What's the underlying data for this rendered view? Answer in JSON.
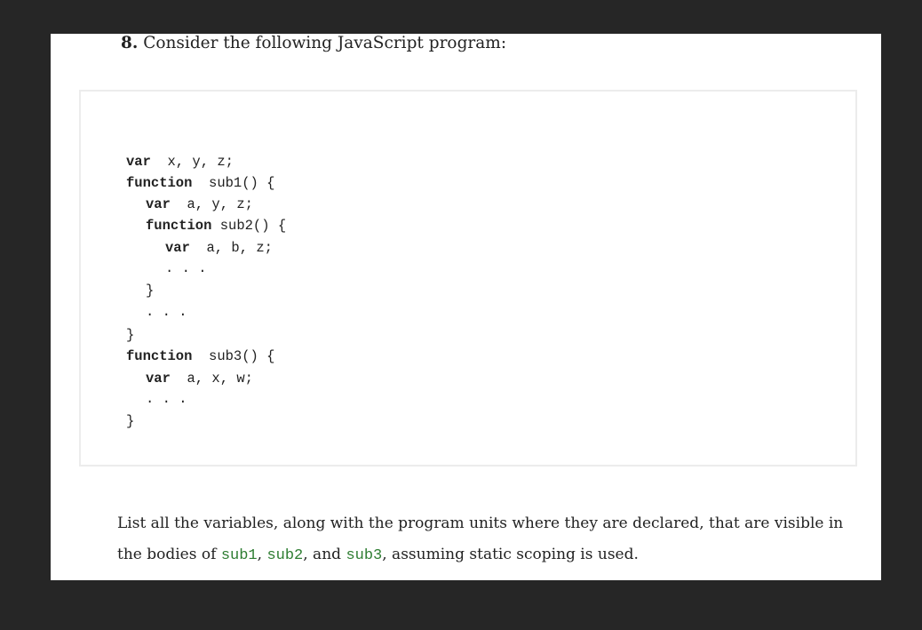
{
  "question": {
    "number": "8.",
    "heading": " Consider the following JavaScript program:"
  },
  "code": {
    "lines": [
      {
        "keyword": "var",
        "rest": "  x, y, z;"
      },
      {
        "keyword": "function",
        "rest": "  sub1() {"
      },
      {
        "keyword": "var",
        "rest": "  a, y, z;"
      },
      {
        "keyword": "function",
        "rest": " sub2() {"
      },
      {
        "keyword": "var",
        "rest": "  a, b, z;"
      },
      {
        "keyword": "",
        "rest": ". . ."
      },
      {
        "keyword": "",
        "rest": "}"
      },
      {
        "keyword": "",
        "rest": ". . ."
      },
      {
        "keyword": "",
        "rest": "}"
      },
      {
        "keyword": "function",
        "rest": "  sub3() {"
      },
      {
        "keyword": "var",
        "rest": "  a, x, w;"
      },
      {
        "keyword": "",
        "rest": ". . ."
      },
      {
        "keyword": "",
        "rest": "}"
      }
    ]
  },
  "prompt": {
    "text_1": "List all the variables, along with the program units where they are declared, that are visible in the bodies of ",
    "code_1": "sub1",
    "sep_1": ", ",
    "code_2": "sub2",
    "sep_2": ", and ",
    "code_3": "sub3",
    "text_2": ", assuming static scoping is used."
  }
}
